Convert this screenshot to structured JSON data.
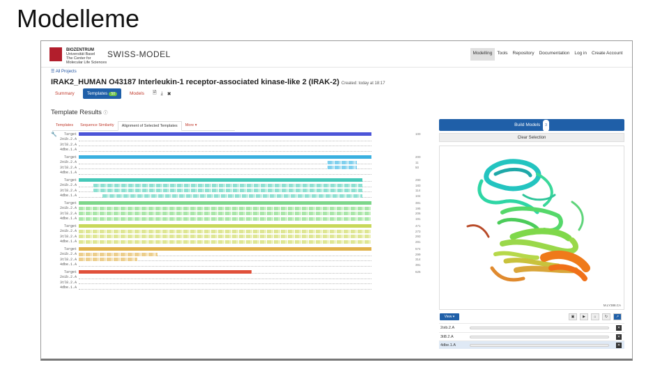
{
  "slide": {
    "title": "Modelleme"
  },
  "app": {
    "institution": "BIOZENTRUM",
    "institution_sub": "Universität Basel",
    "institution_sub2": "The Center for Molecular Life Sciences",
    "name": "SWISS-MODEL"
  },
  "nav": [
    "Modelling",
    "Tools",
    "Repository",
    "Documentation",
    "Log in",
    "Create Account"
  ],
  "projects_link": "All Projects",
  "job": {
    "title": "IRAK2_HUMAN O43187 Interleukin-1 receptor-associated kinase-like 2 (IRAK-2)",
    "created": "Created: today at 18:17"
  },
  "tabs": {
    "summary": "Summary",
    "templates": "Templates",
    "templates_count": "50",
    "models": "Models"
  },
  "results": {
    "title": "Template Results",
    "info": "ⓘ"
  },
  "subtabs": [
    "Templates",
    "Sequence Similarity",
    "Alignment of Selected Templates",
    "More ▾"
  ],
  "alignment": {
    "blocks": [
      {
        "labels": [
          "Target",
          "2oib.2.A",
          "3tl8.2.A",
          "4dbe.1.A"
        ],
        "nums": [
          "100",
          "",
          "",
          ""
        ]
      },
      {
        "labels": [
          "Target",
          "2oib.2.A",
          "3tl8.2.A",
          "4dbe.1.A"
        ],
        "nums": [
          "200",
          "11",
          "50",
          ""
        ]
      },
      {
        "labels": [
          "Target",
          "2oib.2.A",
          "3tl8.2.A",
          "4dbe.1.A"
        ],
        "nums": [
          "290",
          "183",
          "114",
          "104"
        ]
      },
      {
        "labels": [
          "Target",
          "2oib.2.A",
          "3tl8.2.A",
          "4dbe.1.A"
        ],
        "nums": [
          "381",
          "195",
          "206",
          "191"
        ]
      },
      {
        "labels": [
          "Target",
          "2oib.2.A",
          "3tl8.2.A",
          "4dbe.1.A"
        ],
        "nums": [
          "471",
          "273",
          "293",
          "281"
        ]
      },
      {
        "labels": [
          "Target",
          "2oib.2.A",
          "3tl8.2.A",
          "4dbe.1.A"
        ],
        "nums": [
          "574",
          "299",
          "314",
          "391"
        ]
      },
      {
        "labels": [
          "Target",
          "2oib.2.A",
          "3tl8.2.A",
          "4dbe.1.A"
        ],
        "nums": [
          "625",
          "",
          "",
          ""
        ]
      }
    ]
  },
  "panel": {
    "build": "Build Models",
    "build_count": "3",
    "clear": "Clear Selection",
    "viewer_id": "M.LY388.CA",
    "view": "View ▾",
    "controls": [
      "▣",
      "▶",
      "⌂",
      "↻",
      "↗"
    ],
    "templates": [
      {
        "name": "2oib.2.A",
        "selected": false
      },
      {
        "name": "3tl8.2.A",
        "selected": false
      },
      {
        "name": "4dbe.1.A",
        "selected": true
      }
    ]
  },
  "colors": {
    "accent": "#1f5fa8",
    "link": "#c0392b",
    "badge": "#6cc04a"
  }
}
